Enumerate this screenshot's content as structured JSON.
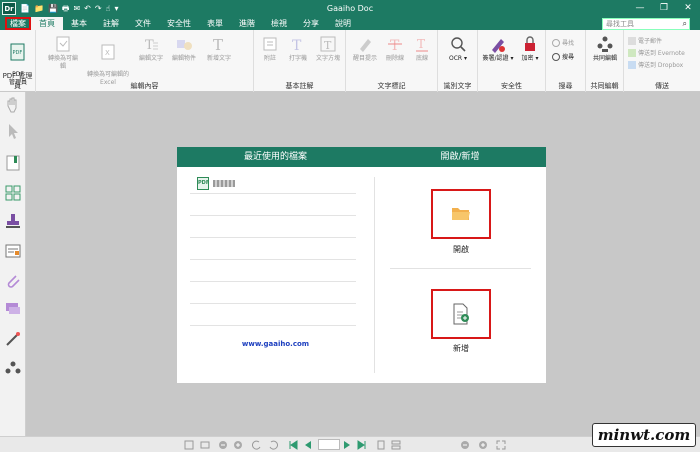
{
  "window": {
    "title": "Gaaiho Doc",
    "logo": "Dr"
  },
  "quick_access": [
    "📄",
    "📁",
    "💾",
    "🖶",
    "✉",
    "↶",
    "↷",
    "☝",
    "▾"
  ],
  "window_controls": [
    "—",
    "❐",
    "✕"
  ],
  "menu": {
    "tabs": [
      "檔案",
      "首頁",
      "基本",
      "註解",
      "文件",
      "安全性",
      "表單",
      "進階",
      "檢視",
      "分享",
      "說明"
    ],
    "active_index": 1,
    "search_placeholder": "尋找工具"
  },
  "ribbon": {
    "groups": {
      "pdf_manager": {
        "label": "PDF 管理員",
        "button": "PDF\n管理員"
      },
      "edit_content": {
        "label": "編輯內容",
        "buttons": [
          "轉換為可編輯",
          "轉換為可編輯的\nExcel",
          "編輯文字",
          "編輯物件",
          "新增文字"
        ]
      },
      "basic_annot": {
        "label": "基本註解",
        "buttons": [
          "附註",
          "打字機",
          "文字方塊"
        ]
      },
      "text_markup": {
        "label": "文字標記",
        "buttons": [
          "醒目提示",
          "刪除線",
          "底線"
        ]
      },
      "ocr": {
        "label": "識別文字",
        "button": "OCR"
      },
      "security": {
        "label": "安全性",
        "buttons": [
          "簽署/認證",
          "加密"
        ]
      },
      "search": {
        "label": "搜尋",
        "items": [
          "尋找",
          "搜尋"
        ]
      },
      "collab": {
        "label": "共同編輯",
        "button": "共同編輯"
      },
      "send": {
        "label": "傳送",
        "items": [
          "電子郵件",
          "傳送到 Evernote",
          "傳送到 Dropbox"
        ]
      }
    }
  },
  "start_panel": {
    "recent_title": "最近使用的檔案",
    "open_title": "開啟/新增",
    "recent_file_icon": "PDF",
    "website": "www.gaaiho.com",
    "open_label": "開啟",
    "new_label": "新增"
  },
  "watermark": "minwt.com",
  "colors": {
    "accent": "#1d7a63",
    "highlight": "#d81818",
    "link": "#1d3fbf"
  }
}
